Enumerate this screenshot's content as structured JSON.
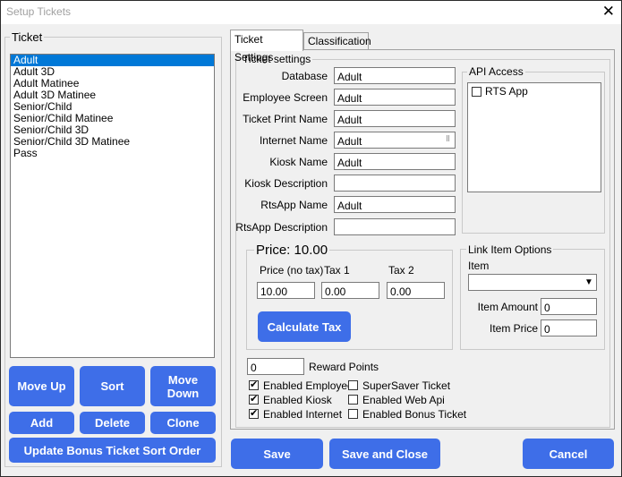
{
  "window": {
    "title": "Setup Tickets",
    "close_glyph": "✕"
  },
  "ticket_group": {
    "label": "Ticket",
    "items": [
      "Adult",
      "Adult 3D",
      "Adult Matinee",
      "Adult 3D Matinee",
      "Senior/Child",
      "Senior/Child Matinee",
      "Senior/Child 3D",
      "Senior/Child 3D Matinee",
      "Pass"
    ],
    "selected_index": 0
  },
  "left_buttons": {
    "move_up": "Move Up",
    "sort": "Sort",
    "move_down_1": "Move",
    "move_down_2": "Down",
    "add": "Add",
    "delete": "Delete",
    "clone": "Clone",
    "update_bonus": "Update Bonus Ticket Sort Order"
  },
  "tabs": [
    {
      "label": "Ticket Settings",
      "active": true
    },
    {
      "label": "Classification",
      "active": false
    }
  ],
  "ticket_settings": {
    "group_label": "Ticket settings",
    "fields": {
      "database": {
        "label": "Database",
        "value": "Adult"
      },
      "employee_screen": {
        "label": "Employee Screen",
        "value": "Adult"
      },
      "ticket_print_name": {
        "label": "Ticket Print Name",
        "value": "Adult"
      },
      "internet_name": {
        "label": "Internet Name",
        "value": "Adult"
      },
      "kiosk_name": {
        "label": "Kiosk Name",
        "value": "Adult"
      },
      "kiosk_description": {
        "label": "Kiosk Description",
        "value": ""
      },
      "rtsapp_name": {
        "label": "RtsApp Name",
        "value": "Adult"
      },
      "rtsapp_description": {
        "label": "RtsApp Description",
        "value": ""
      }
    }
  },
  "api_access": {
    "label": "API Access",
    "items": [
      {
        "label": "RTS App",
        "checked": false
      }
    ]
  },
  "price": {
    "label": "Price: 10.00",
    "price_label": "Price (no tax)",
    "price_value": "10.00",
    "tax1_label": "Tax 1",
    "tax1_value": "0.00",
    "tax2_label": "Tax 2",
    "tax2_value": "0.00",
    "calculate_button": "Calculate Tax"
  },
  "link_item": {
    "label": "Link Item Options",
    "item_label": "Item",
    "item_value": "",
    "amount_label": "Item Amount",
    "amount_value": "0",
    "price_label": "Item Price",
    "price_value": "0"
  },
  "reward": {
    "value": "0",
    "label": "Reward Points"
  },
  "checkboxes": {
    "enabled_employee": {
      "label": "Enabled Employee",
      "checked": true
    },
    "enabled_kiosk": {
      "label": "Enabled Kiosk",
      "checked": true
    },
    "enabled_internet": {
      "label": "Enabled Internet",
      "checked": true
    },
    "supersaver": {
      "label": "SuperSaver Ticket",
      "checked": false
    },
    "enabled_web_api": {
      "label": "Enabled Web Api",
      "checked": false
    },
    "enabled_bonus": {
      "label": "Enabled Bonus Ticket",
      "checked": false
    }
  },
  "bottom_buttons": {
    "save": "Save",
    "save_close": "Save and Close",
    "cancel": "Cancel"
  },
  "colors": {
    "button_blue": "#3e6ee8",
    "selection_blue": "#0078d7"
  }
}
